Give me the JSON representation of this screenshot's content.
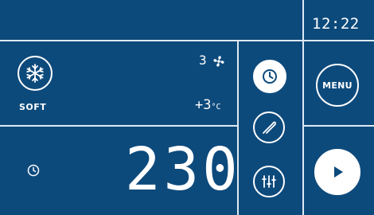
{
  "status": {
    "time": "12:22"
  },
  "mode": {
    "icon": "snowflake-icon",
    "label": "SOFT"
  },
  "fan": {
    "level": "3",
    "icon": "fan-icon"
  },
  "temperature": {
    "value": "+3",
    "unit": "°C"
  },
  "timer": {
    "value": "230",
    "icon": "clock-icon"
  },
  "controls": {
    "clock_icon": "clock-icon",
    "probe_icon": "probe-icon",
    "settings_icon": "sliders-icon",
    "menu_label": "MENU",
    "start_icon": "play-icon"
  },
  "colors": {
    "background": "#0d4a7c",
    "foreground": "#ffffff",
    "divider": "#dfe9f3"
  }
}
